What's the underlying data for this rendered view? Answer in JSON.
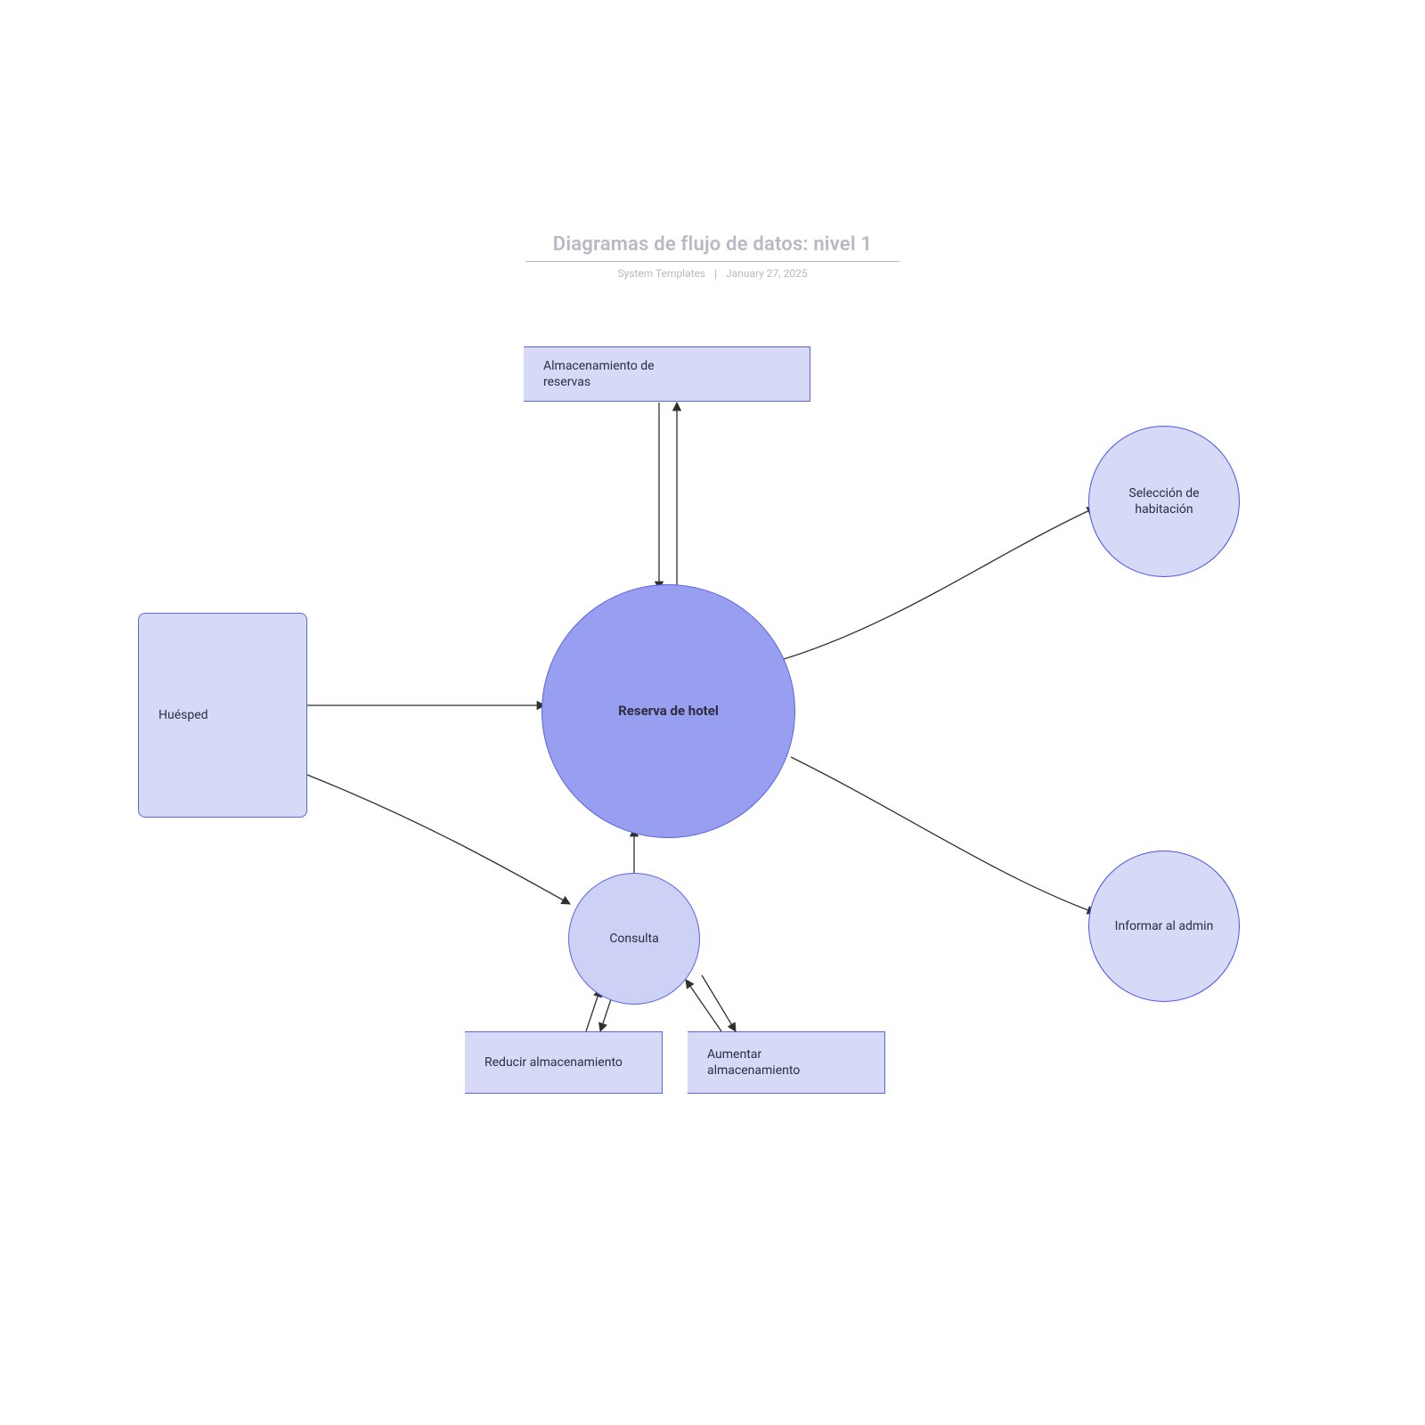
{
  "header": {
    "title": "Diagramas de flujo de datos: nivel 1",
    "subtitle_left": "System Templates",
    "subtitle_right": "January 27, 2025"
  },
  "nodes": {
    "guest": "Huésped",
    "booking_store": "Almacenamiento de reservas",
    "hotel_booking": "Reserva de hotel",
    "room_select": "Selección de habitación",
    "inform_admin": "Informar al admin",
    "query": "Consulta",
    "reduce_store": "Reducir almacenamiento",
    "increase_store": "Aumentar almacenamiento"
  }
}
